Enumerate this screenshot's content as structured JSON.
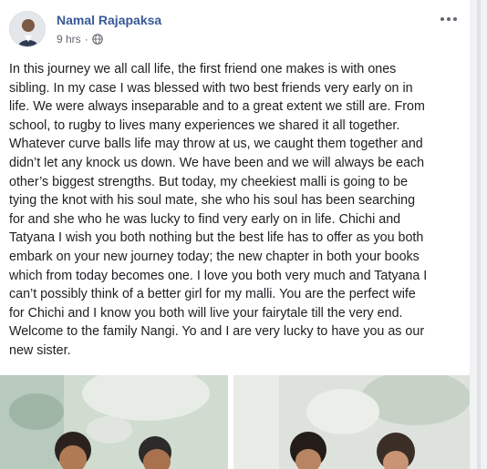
{
  "post": {
    "author": "Namal Rajapaksa",
    "time": "9 hrs",
    "separator": "·",
    "body": "In this journey we all call life, the first friend one makes is with ones\nsibling. In my case I was blessed with two best friends very early on in\nlife. We were always inseparable and to a great extent we still are. From\nschool, to rugby to lives many experiences we shared it all together.\nWhatever curve balls life may throw at us, we caught them together and\ndidn’t let any knock us down. We have been and we will always be each\nother’s biggest strengths. But today, my cheekiest malli is going to be\ntying the knot with his soul mate, she who his soul has been searching\nfor and she who he was lucky to find very early on in life. Chichi and\nTatyana I wish you both nothing but the best life has to offer as you both\nembark on your new journey today; the new chapter in both your books\nwhich from today becomes one. I love you both very much and Tatyana I\ncan’t possibly think of a better girl for my malli. You are the perfect wife\nfor Chichi and I know you both will live your fairytale till the very end.\nWelcome to the family Nangi. Yo and I are very lucky to have you as our\nnew sister."
  },
  "icons": {
    "privacy": "globe-icon",
    "more": "more-options-icon"
  }
}
